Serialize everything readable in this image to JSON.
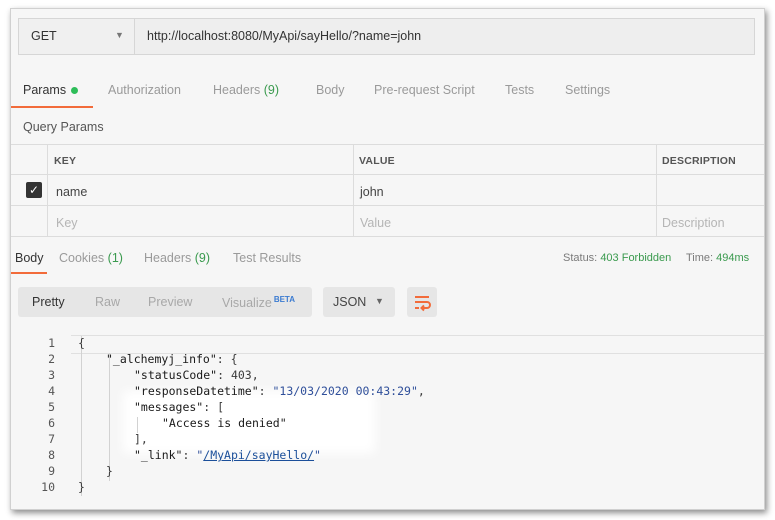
{
  "request": {
    "method": "GET",
    "url": "http://localhost:8080/MyApi/sayHello/?name=john"
  },
  "request_tabs": [
    {
      "label": "Params",
      "count": "",
      "active": true,
      "indicator": "green-dot"
    },
    {
      "label": "Authorization",
      "count": ""
    },
    {
      "label": "Headers",
      "count": "(9)"
    },
    {
      "label": "Body",
      "count": ""
    },
    {
      "label": "Pre-request Script",
      "count": ""
    },
    {
      "label": "Tests",
      "count": ""
    },
    {
      "label": "Settings",
      "count": ""
    }
  ],
  "query_params": {
    "title": "Query Params",
    "columns": [
      "KEY",
      "VALUE",
      "DESCRIPTION"
    ],
    "rows": [
      {
        "checked": true,
        "key": "name",
        "value": "john",
        "description": ""
      }
    ],
    "placeholders": {
      "key": "Key",
      "value": "Value",
      "description": "Description"
    }
  },
  "response_tabs": [
    {
      "label": "Body",
      "count": "",
      "active": true
    },
    {
      "label": "Cookies",
      "count": "(1)"
    },
    {
      "label": "Headers",
      "count": "(9)"
    },
    {
      "label": "Test Results",
      "count": ""
    }
  ],
  "response_status": {
    "status_label": "Status:",
    "status_value": "403 Forbidden",
    "time_label": "Time:",
    "time_value": "494ms"
  },
  "format_options": [
    {
      "label": "Pretty",
      "active": true
    },
    {
      "label": "Raw"
    },
    {
      "label": "Preview"
    },
    {
      "label": "Visualize",
      "badge": "BETA"
    }
  ],
  "body_format": "JSON",
  "colors": {
    "accent": "#f26b3a",
    "status_ok": "#3a9a4e",
    "dot": "#2ebd59",
    "link": "#1b4f9a"
  },
  "response_body": {
    "line_numbers": [
      "1",
      "2",
      "3",
      "4",
      "5",
      "6",
      "7",
      "8",
      "9",
      "10"
    ],
    "lines": {
      "l1": "{",
      "l2_key": "\"_alchemyj_info\"",
      "l2_rest": ": {",
      "l3_key": "\"statusCode\"",
      "l3_rest": ": 403,",
      "l4_key": "\"responseDatetime\"",
      "l4_sep": ": ",
      "l4_val": "\"13/03/2020 00:43:29\"",
      "l4_end": ",",
      "l5_key": "\"messages\"",
      "l5_rest": ": [",
      "l6_val": "\"Access is denied\"",
      "l7": "],",
      "l8_key": "\"_link\"",
      "l8_sep": ": ",
      "l8_q1": "\"",
      "l8_link": "/MyApi/sayHello/",
      "l8_q2": "\"",
      "l9": "}",
      "l10": "}"
    }
  }
}
